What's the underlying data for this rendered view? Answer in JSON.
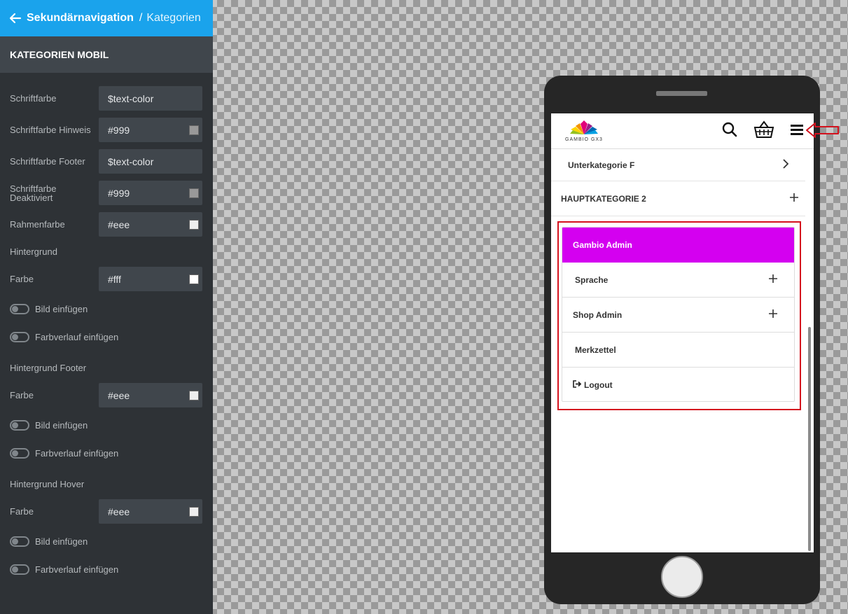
{
  "topbar": {
    "breadcrumb_main": "Sekundärnavigation",
    "separator": "/",
    "breadcrumb_sub": "Kategorien"
  },
  "section": {
    "title": "KATEGORIEN MOBIL"
  },
  "fields": [
    {
      "label": "Schriftfarbe",
      "value": "$text-color"
    },
    {
      "label": "Schriftfarbe Hinweis",
      "value": "#999",
      "swatch": "#999999"
    },
    {
      "label": "Schriftfarbe Footer",
      "value": "$text-color"
    },
    {
      "label": "Schriftfarbe Deaktiviert",
      "value": "#999",
      "swatch": "#999999"
    },
    {
      "label": "Rahmenfarbe",
      "value": "#eee",
      "swatch": "#eeeeee"
    }
  ],
  "background": {
    "heading": "Hintergrund",
    "color_label": "Farbe",
    "color_value": "#fff",
    "swatch": "#ffffff",
    "image_toggle": "Bild einfügen",
    "gradient_toggle": "Farbverlauf einfügen"
  },
  "background_footer": {
    "heading": "Hintergrund Footer",
    "color_label": "Farbe",
    "color_value": "#eee",
    "swatch": "#eeeeee",
    "image_toggle": "Bild einfügen",
    "gradient_toggle": "Farbverlauf einfügen"
  },
  "background_hover": {
    "heading": "Hintergrund Hover",
    "color_label": "Farbe",
    "color_value": "#eee",
    "swatch": "#eeeeee",
    "image_toggle": "Bild einfügen",
    "gradient_toggle": "Farbverlauf einfügen"
  },
  "preview": {
    "logo_text": "GAMBIO GX3",
    "subcategory": "Unterkategorie F",
    "main_category": "HAUPTKATEGORIE 2",
    "menu": [
      {
        "label": "Gambio Admin",
        "active": true
      },
      {
        "label": "Sprache",
        "expandable": true
      },
      {
        "label": "Shop Admin",
        "expandable": true
      },
      {
        "label": "Merkzettel"
      },
      {
        "label": "Logout",
        "icon": "logout-icon"
      }
    ],
    "accent_color": "#d400f0",
    "highlight_color": "#d4121e"
  },
  "colors": {
    "topbar": "#1aa3ec",
    "sidebar_bg": "#2e3236",
    "input_bg": "#40464c"
  }
}
